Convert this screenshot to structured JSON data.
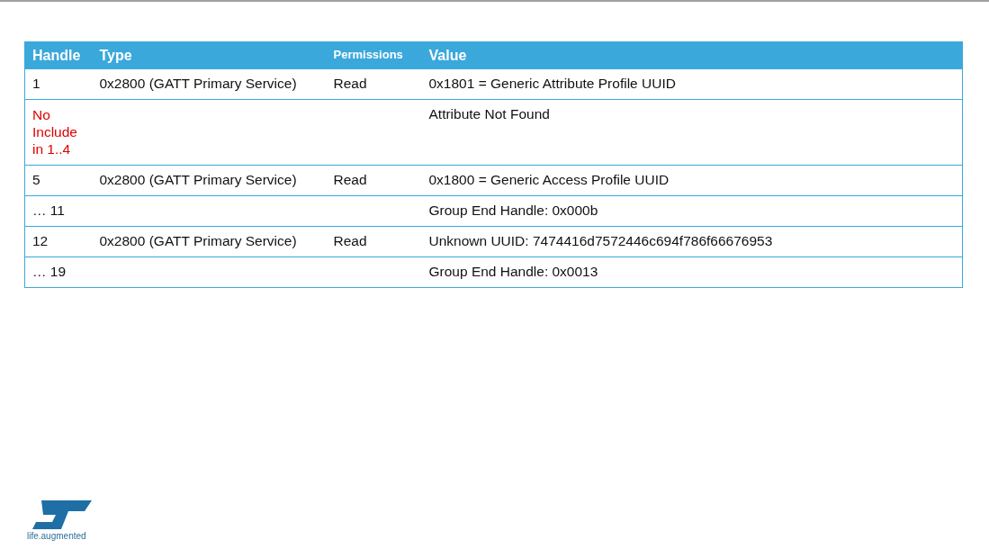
{
  "table": {
    "columns": [
      {
        "label": "Handle",
        "kind": "normal"
      },
      {
        "label": "Type",
        "kind": "normal"
      },
      {
        "label": "Permissions",
        "kind": "small"
      },
      {
        "label": "Value",
        "kind": "normal"
      }
    ],
    "rows": [
      {
        "kind": "normal",
        "handle": "1",
        "type": "0x2800 (GATT Primary Service)",
        "permissions": "Read",
        "value": "0x1801 = Generic Attribute Profile UUID"
      },
      {
        "kind": "note",
        "handle": "No Include in 1..4",
        "value": "Attribute Not Found"
      },
      {
        "kind": "normal",
        "handle": "5",
        "type": "0x2800 (GATT Primary Service)",
        "permissions": "Read",
        "value": "0x1800 = Generic Access Profile UUID"
      },
      {
        "kind": "normal",
        "handle": "… 11",
        "value": "Group End Handle: 0x000b"
      },
      {
        "kind": "normal",
        "handle": "12",
        "type": "0x2800 (GATT Primary Service)",
        "permissions": "Read",
        "value": "Unknown UUID: 7474416d7572446c694f786f66676953"
      },
      {
        "kind": "normal",
        "handle": "… 19",
        "value": "Group End Handle: 0x0013"
      }
    ]
  },
  "logo": {
    "tagline": "life.augmented"
  }
}
